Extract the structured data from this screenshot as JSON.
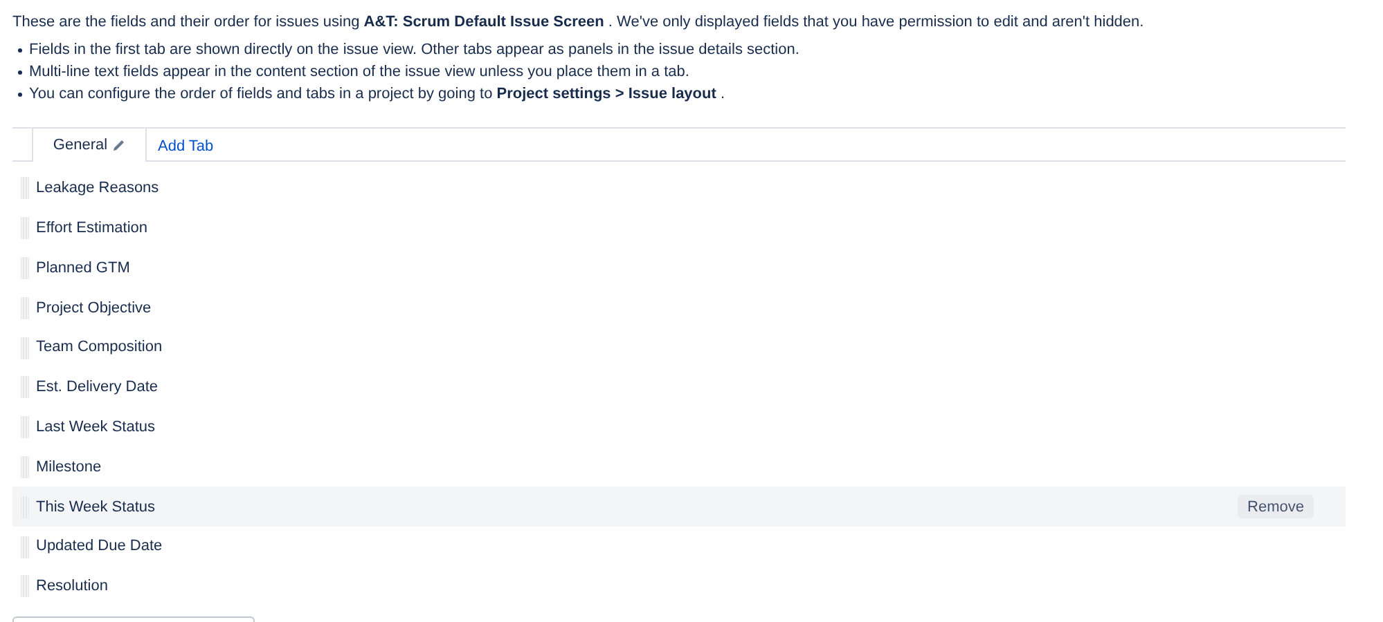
{
  "intro": "These are the fields and their order for issues using **A&T: Scrum Default Issue Screen** . We've only displayed fields that you have permission to edit and aren't hidden.",
  "notes": [
    "Fields in the first tab are shown directly on the issue view. Other tabs appear as panels in the issue details section.",
    "Multi-line text fields appear in the content section of the issue view unless you place them in a tab.",
    "You can configure the order of fields and tabs in a project by going to **Project settings > Issue layout** ."
  ],
  "tabs": [
    {
      "label": "General",
      "selected": true
    }
  ],
  "add_tab": "Add Tab",
  "fields": [
    {
      "name": "Leakage Reasons"
    },
    {
      "name": "Effort Estimation"
    },
    {
      "name": "Planned GTM"
    },
    {
      "name": "Project Objective"
    },
    {
      "name": "Team Composition"
    },
    {
      "name": "Est. Delivery Date"
    },
    {
      "name": "Last Week Status"
    },
    {
      "name": "Milestone"
    },
    {
      "name": "This Week Status",
      "action": "Remove"
    },
    {
      "name": "Updated Due Date"
    },
    {
      "name": "Resolution"
    }
  ]
}
